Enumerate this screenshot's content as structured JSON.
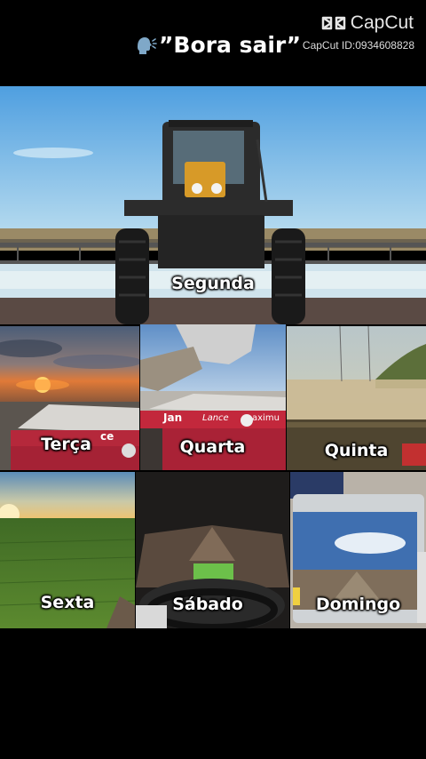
{
  "watermark": {
    "brand": "CapCut",
    "id_text": "CapCut ID:0934608828"
  },
  "caption": {
    "icon": "speaking-head-icon",
    "text": "”Bora sair”"
  },
  "days": {
    "segunda": "Segunda",
    "terca": "Terça",
    "quarta": "Quarta",
    "quinta": "Quinta",
    "sexta": "Sexta",
    "sabado": "Sábado",
    "domingo": "Domingo"
  },
  "signage": {
    "trailer_text": "Jan",
    "trailer_text2": "Lance",
    "trailer_text3": "aximu",
    "trailer_text4": "ce"
  }
}
